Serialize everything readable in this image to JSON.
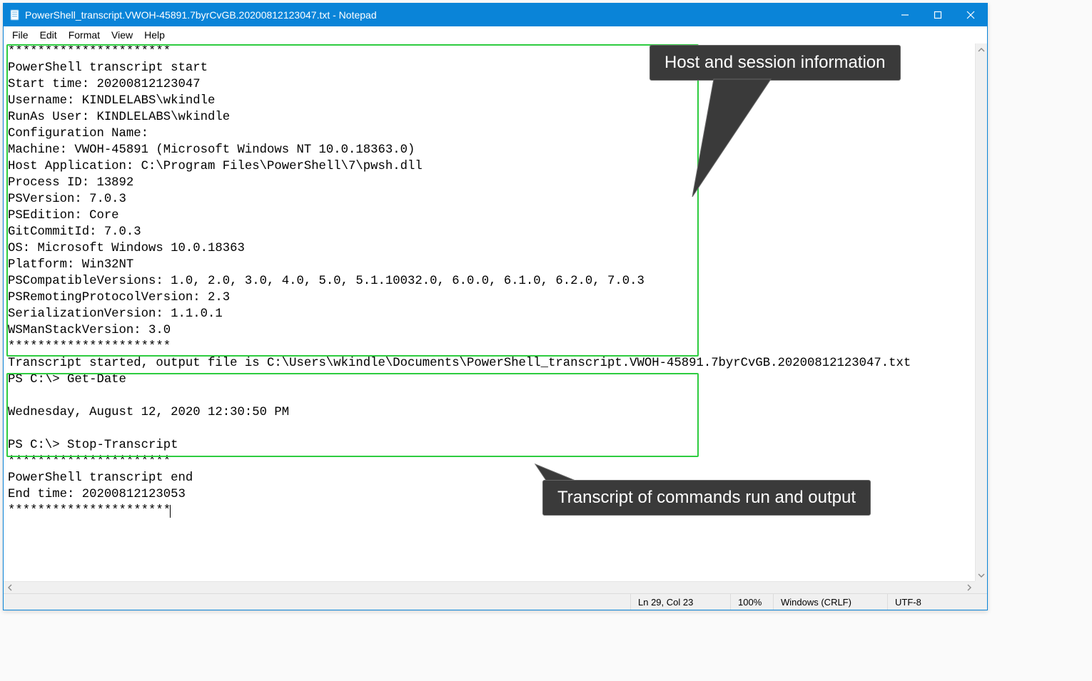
{
  "window": {
    "title": "PowerShell_transcript.VWOH-45891.7byrCvGB.20200812123047.txt - Notepad"
  },
  "menu": {
    "items": [
      "File",
      "Edit",
      "Format",
      "View",
      "Help"
    ]
  },
  "content": {
    "lines": [
      "**********************",
      "PowerShell transcript start",
      "Start time: 20200812123047",
      "Username: KINDLELABS\\wkindle",
      "RunAs User: KINDLELABS\\wkindle",
      "Configuration Name:",
      "Machine: VWOH-45891 (Microsoft Windows NT 10.0.18363.0)",
      "Host Application: C:\\Program Files\\PowerShell\\7\\pwsh.dll",
      "Process ID: 13892",
      "PSVersion: 7.0.3",
      "PSEdition: Core",
      "GitCommitId: 7.0.3",
      "OS: Microsoft Windows 10.0.18363",
      "Platform: Win32NT",
      "PSCompatibleVersions: 1.0, 2.0, 3.0, 4.0, 5.0, 5.1.10032.0, 6.0.0, 6.1.0, 6.2.0, 7.0.3",
      "PSRemotingProtocolVersion: 2.3",
      "SerializationVersion: 1.1.0.1",
      "WSManStackVersion: 3.0",
      "**********************",
      "Transcript started, output file is C:\\Users\\wkindle\\Documents\\PowerShell_transcript.VWOH-45891.7byrCvGB.20200812123047.txt",
      "PS C:\\> Get-Date",
      "",
      "Wednesday, August 12, 2020 12:30:50 PM",
      "",
      "PS C:\\> Stop-Transcript",
      "**********************",
      "PowerShell transcript end",
      "End time: 20200812123053",
      "**********************"
    ]
  },
  "annotations": {
    "callout1": "Host and session information",
    "callout2": "Transcript of commands run and output"
  },
  "status": {
    "position": "Ln 29, Col 23",
    "zoom": "100%",
    "line_ending": "Windows (CRLF)",
    "encoding": "UTF-8"
  }
}
